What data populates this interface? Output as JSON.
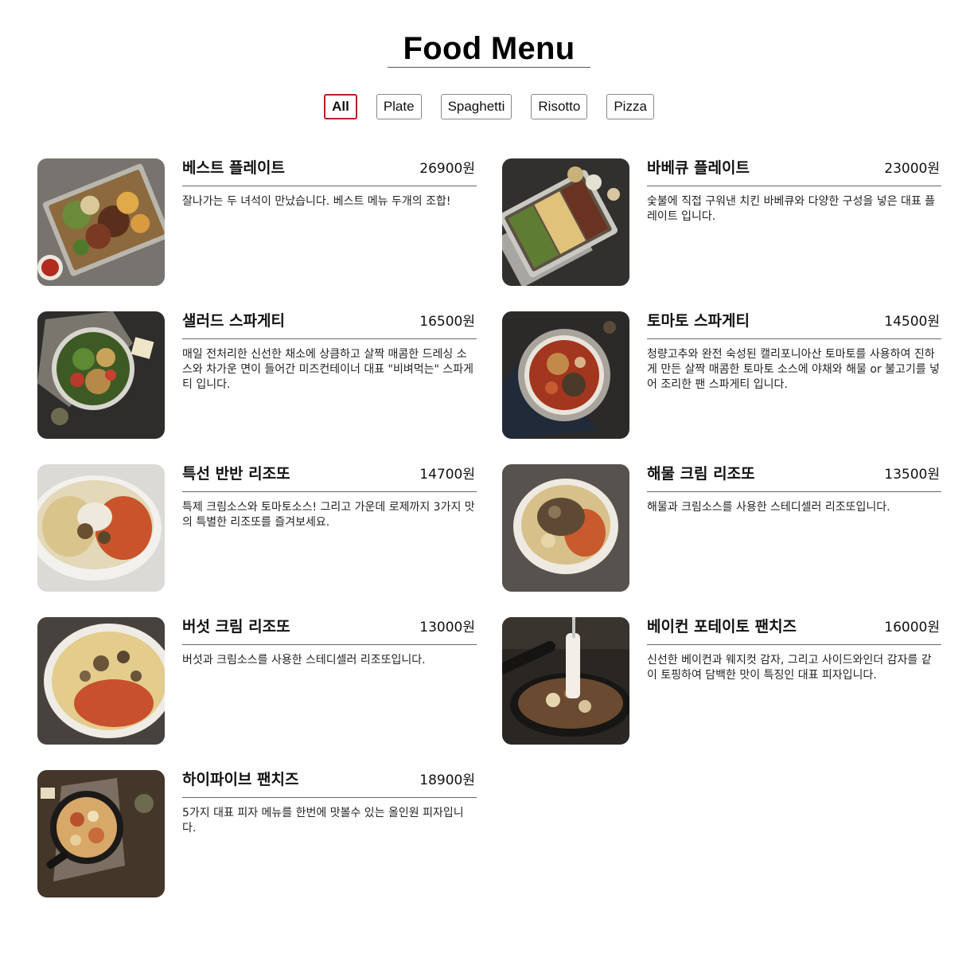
{
  "header": {
    "title": "Food Menu"
  },
  "tabs": [
    {
      "label": "All",
      "active": true
    },
    {
      "label": "Plate",
      "active": false
    },
    {
      "label": "Spaghetti",
      "active": false
    },
    {
      "label": "Risotto",
      "active": false
    },
    {
      "label": "Pizza",
      "active": false
    }
  ],
  "colors": {
    "active_tab_border": "#b22222",
    "divider": "#666666",
    "text": "#111111"
  },
  "menu": [
    {
      "name": "베스트 플레이트",
      "price": "26900원",
      "desc": "잘나가는 두 녀석이 만났습니다. 베스트 메뉴 두개의 조합!",
      "photo": "best-plate-photo"
    },
    {
      "name": "바베큐 플레이트",
      "price": "23000원",
      "desc": "숯불에 직접 구워낸 치킨 바베큐와 다양한 구성을 넣은 대표 플레이트 입니다.",
      "photo": "bbq-plate-photo"
    },
    {
      "name": "샐러드 스파게티",
      "price": "16500원",
      "desc": "매일 전처리한 신선한 채소에 상큼하고 살짝 매콤한 드레싱 소스와 차가운 면이 들어간 미즈컨테이너 대표 \"비벼먹는\" 스파게티 입니다.",
      "photo": "salad-spaghetti-photo"
    },
    {
      "name": "토마토 스파게티",
      "price": "14500원",
      "desc": "청량고추와 완전 숙성된 캘리포니아산 토마토를 사용하여 진하게 만든 살짝 매콤한 토마토 소스에 야채와 해물 or 불고기를 넣어 조리한 팬 스파게티 입니다.",
      "photo": "tomato-spaghetti-photo"
    },
    {
      "name": "특선 반반 리조또",
      "price": "14700원",
      "desc": "특제 크림소스와 토마토소스! 그리고 가운데 로제까지 3가지 맛의 특별한 리조또를 즐겨보세요.",
      "photo": "half-half-risotto-photo"
    },
    {
      "name": "해물 크림 리조또",
      "price": "13500원",
      "desc": "해물과 크림소스를 사용한 스테디셀러 리조또입니다.",
      "photo": "seafood-cream-risotto-photo"
    },
    {
      "name": "버섯 크림 리조또",
      "price": "13000원",
      "desc": "버섯과 크림소스를 사용한 스테디셀러 리조또입니다.",
      "photo": "mushroom-cream-risotto-photo"
    },
    {
      "name": "베이컨 포테이토 팬치즈",
      "price": "16000원",
      "desc": "신선한 베이컨과 웨지컷 감자, 그리고 사이드와인더 감자를 같이 토핑하여 담백한 맛이 특징인 대표 피자입니다.",
      "photo": "bacon-potato-pan-cheese-photo"
    },
    {
      "name": "하이파이브 팬치즈",
      "price": "18900원",
      "desc": "5가지 대표 피자 메뉴를 한번에 맛볼수 있는 올인원 피자입니다.",
      "photo": "high-five-pan-cheese-photo"
    }
  ]
}
